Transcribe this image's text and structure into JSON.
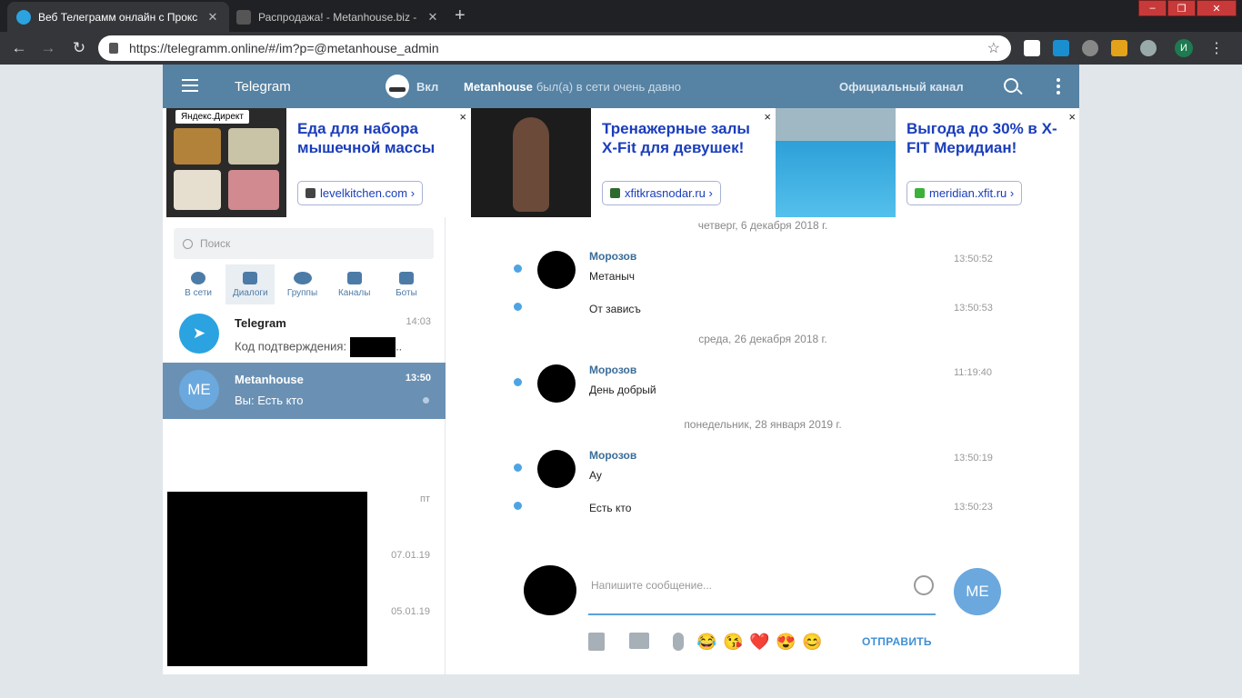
{
  "browser": {
    "tabs": [
      {
        "title": "Веб Телеграмм онлайн с Прокс",
        "active": true
      },
      {
        "title": "Распродажа! - Metanhouse.biz -",
        "active": false
      }
    ],
    "url": "https://telegramm.online/#/im?p=@metanhouse_admin",
    "profile_initial": "И"
  },
  "app": {
    "title": "Telegram",
    "incognito_label": "Вкл",
    "chat_name": "Metanhouse",
    "chat_status": "был(а) в сети очень давно",
    "channel_label": "Официальный канал"
  },
  "ads": {
    "provider": "Яндекс.Директ",
    "items": [
      {
        "title": "Еда для набора мышечной массы",
        "link": "levelkitchen.com ›"
      },
      {
        "title": "Тренажерные залы X-Fit для девушек!",
        "link": "xfitkrasnodar.ru ›"
      },
      {
        "title": "Выгода до 30% в X-FIT Меридиан!",
        "link": "meridian.xfit.ru ›"
      }
    ],
    "close": "×"
  },
  "sidebar": {
    "search_placeholder": "Поиск",
    "filters": [
      {
        "label": "В сети",
        "active": false
      },
      {
        "label": "Диалоги",
        "active": true
      },
      {
        "label": "Группы",
        "active": false
      },
      {
        "label": "Каналы",
        "active": false
      },
      {
        "label": "Боты",
        "active": false
      }
    ],
    "dialogs": [
      {
        "name": "Telegram",
        "text": "Код подтверждения:",
        "suffix": "..",
        "time": "14:03"
      },
      {
        "name": "Metanhouse",
        "initials": "ME",
        "text": "Вы: Есть кто",
        "time": "13:50"
      }
    ],
    "extra_times": [
      "пт",
      "07.01.19",
      "05.01.19"
    ]
  },
  "chat": {
    "groups": [
      {
        "date": "четверг, 6 декабря 2018 г."
      },
      {
        "date": "среда, 26 декабря 2018 г."
      },
      {
        "date": "понедельник, 28 января 2019 г."
      }
    ],
    "messages": [
      {
        "author": "Морозов",
        "text": "Метаныч",
        "time": "13:50:52"
      },
      {
        "text": "От зависъ",
        "time": "13:50:53"
      },
      {
        "author": "Морозов",
        "text": "День добрый",
        "time": "11:19:40"
      },
      {
        "author": "Морозов",
        "text": "Ау",
        "time": "13:50:19"
      },
      {
        "text": "Есть кто",
        "time": "13:50:23"
      }
    ],
    "input_placeholder": "Напишите сообщение...",
    "me_initials": "ME",
    "send_label": "ОТПРАВИТЬ",
    "emojis": [
      "😂",
      "😘",
      "❤️",
      "😍",
      "😊"
    ]
  }
}
